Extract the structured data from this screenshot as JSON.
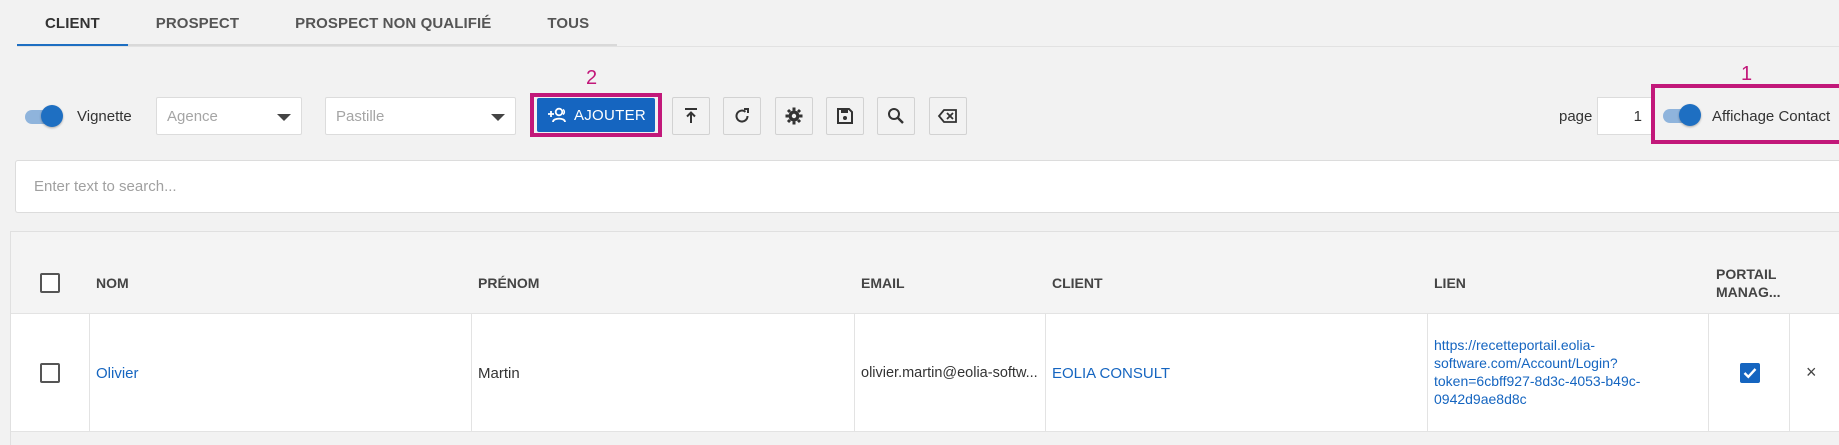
{
  "tabs": [
    {
      "label": "CLIENT",
      "active": true
    },
    {
      "label": "PROSPECT",
      "active": false
    },
    {
      "label": "PROSPECT NON QUALIFIÉ",
      "active": false
    },
    {
      "label": "TOUS",
      "active": false
    }
  ],
  "toolbar": {
    "vignette_label": "Vignette",
    "agence_placeholder": "Agence",
    "pastille_placeholder": "Pastille",
    "add_label": "AJOUTER",
    "page_label": "page",
    "page_value": "1",
    "affichage_label": "Affichage Contact",
    "annotation_add": "2",
    "annotation_toggle": "1"
  },
  "search": {
    "placeholder": "Enter text to search..."
  },
  "table": {
    "headers": {
      "nom": "NOM",
      "prenom": "PRÉNOM",
      "email": "EMAIL",
      "client": "CLIENT",
      "lien": "LIEN",
      "portail_line1": "PORTAIL",
      "portail_line2": "MANAG..."
    },
    "rows": [
      {
        "nom": "Olivier",
        "prenom": "Martin",
        "email": "olivier.martin@eolia-softw...",
        "client": "EOLIA CONSULT",
        "lien_lines": [
          "https://recetteportail.eolia-",
          "software.com/Account/Login?",
          "token=6cbff927-8d3c-4053-b49c-",
          "0942d9ae8d8c"
        ],
        "portail_checked": true,
        "close": "×"
      }
    ]
  },
  "colors": {
    "accent": "#1565c0",
    "highlight": "#c2187a"
  }
}
